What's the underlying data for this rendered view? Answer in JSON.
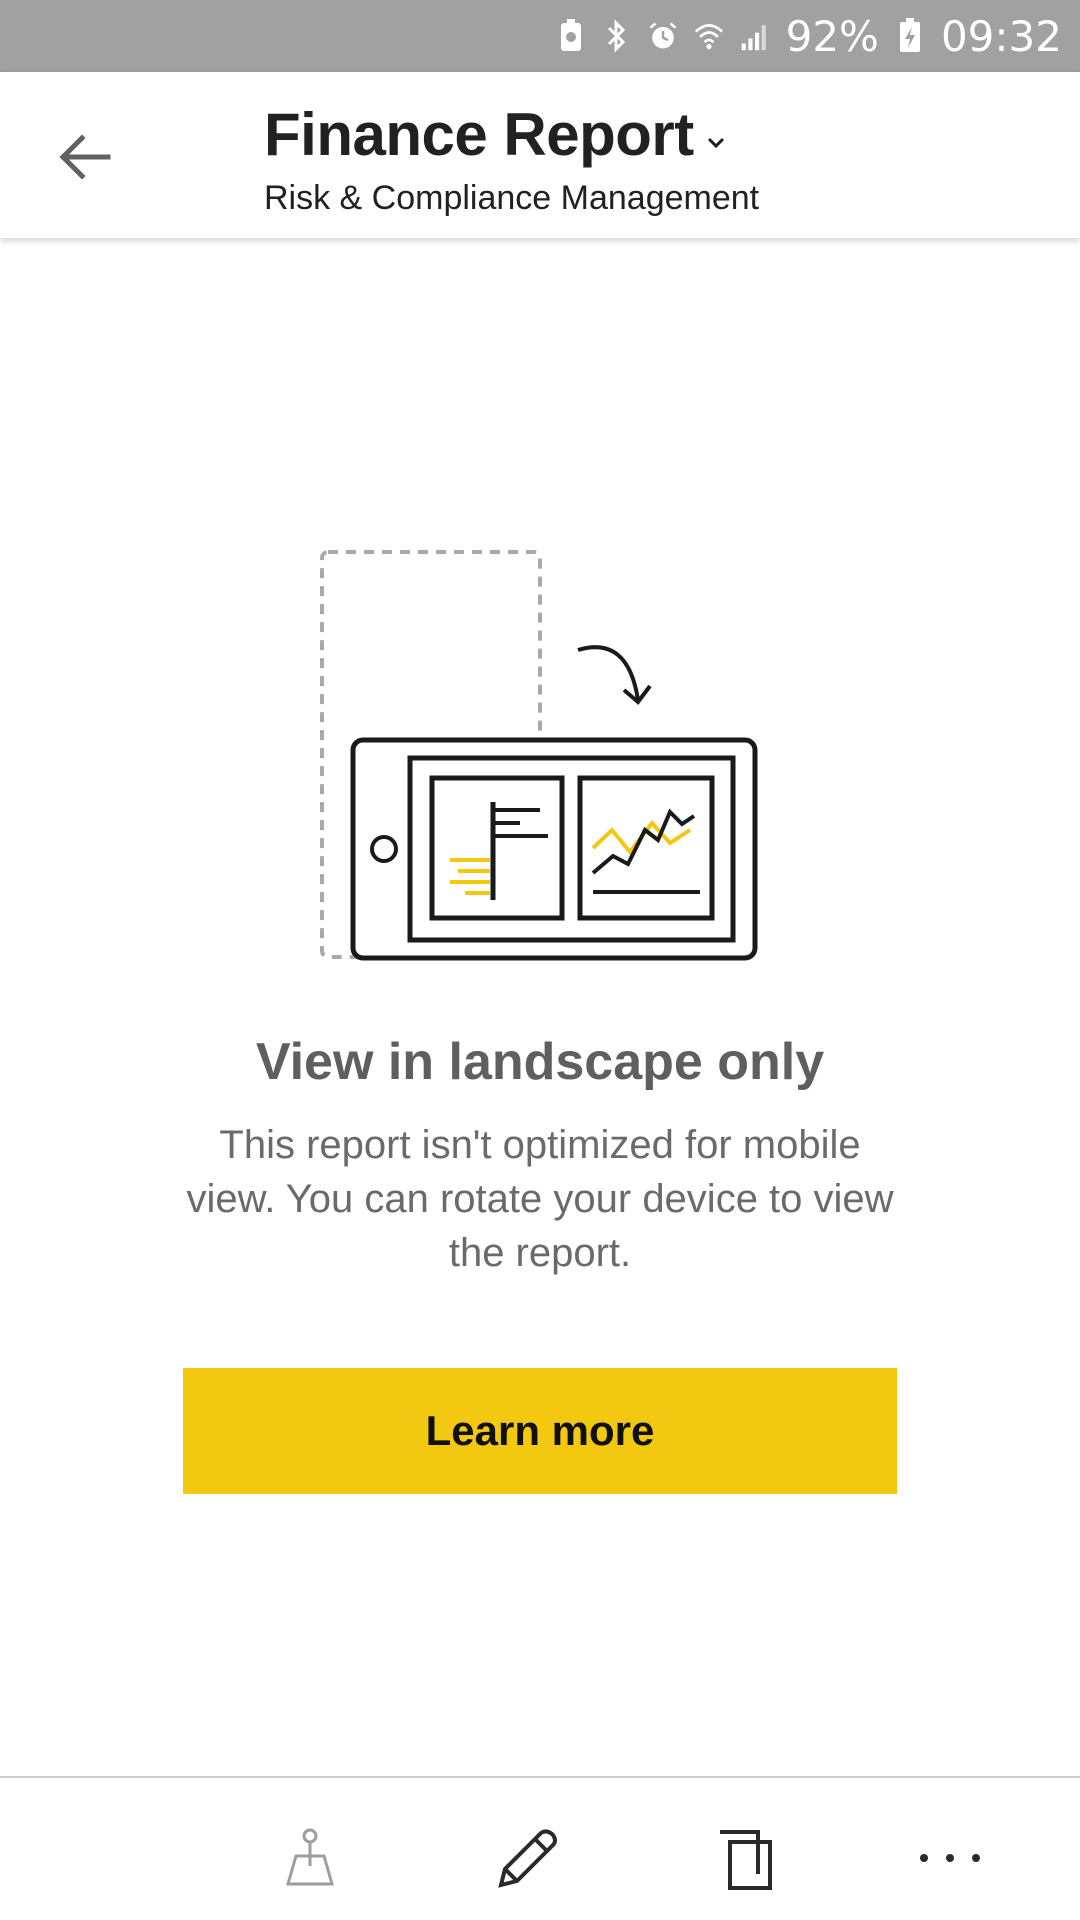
{
  "status_bar": {
    "battery_percent": "92%",
    "time": "09:32",
    "icons": [
      "battery-saver-icon",
      "bluetooth-icon",
      "alarm-icon",
      "wifi-icon",
      "signal-icon",
      "charging-battery-icon"
    ]
  },
  "app_bar": {
    "title": "Finance Report",
    "subtitle": "Risk & Compliance Management",
    "back_icon": "arrow-left-icon",
    "dropdown_icon": "chevron-down-icon"
  },
  "main": {
    "illustration_icon": "rotate-device-illustration",
    "heading": "View in landscape only",
    "description": "This report isn't optimized for mobile view. You can rotate your device to view the report.",
    "learn_more_label": "Learn more"
  },
  "bottom_bar": {
    "tools": [
      "map-pin-icon",
      "pencil-icon",
      "duplicate-icon",
      "more-icon"
    ]
  },
  "colors": {
    "accent_yellow": "#f2c811",
    "status_bar_bg": "#a1a1a1",
    "text_dark": "#212121",
    "text_gray": "#5f5f5f"
  }
}
